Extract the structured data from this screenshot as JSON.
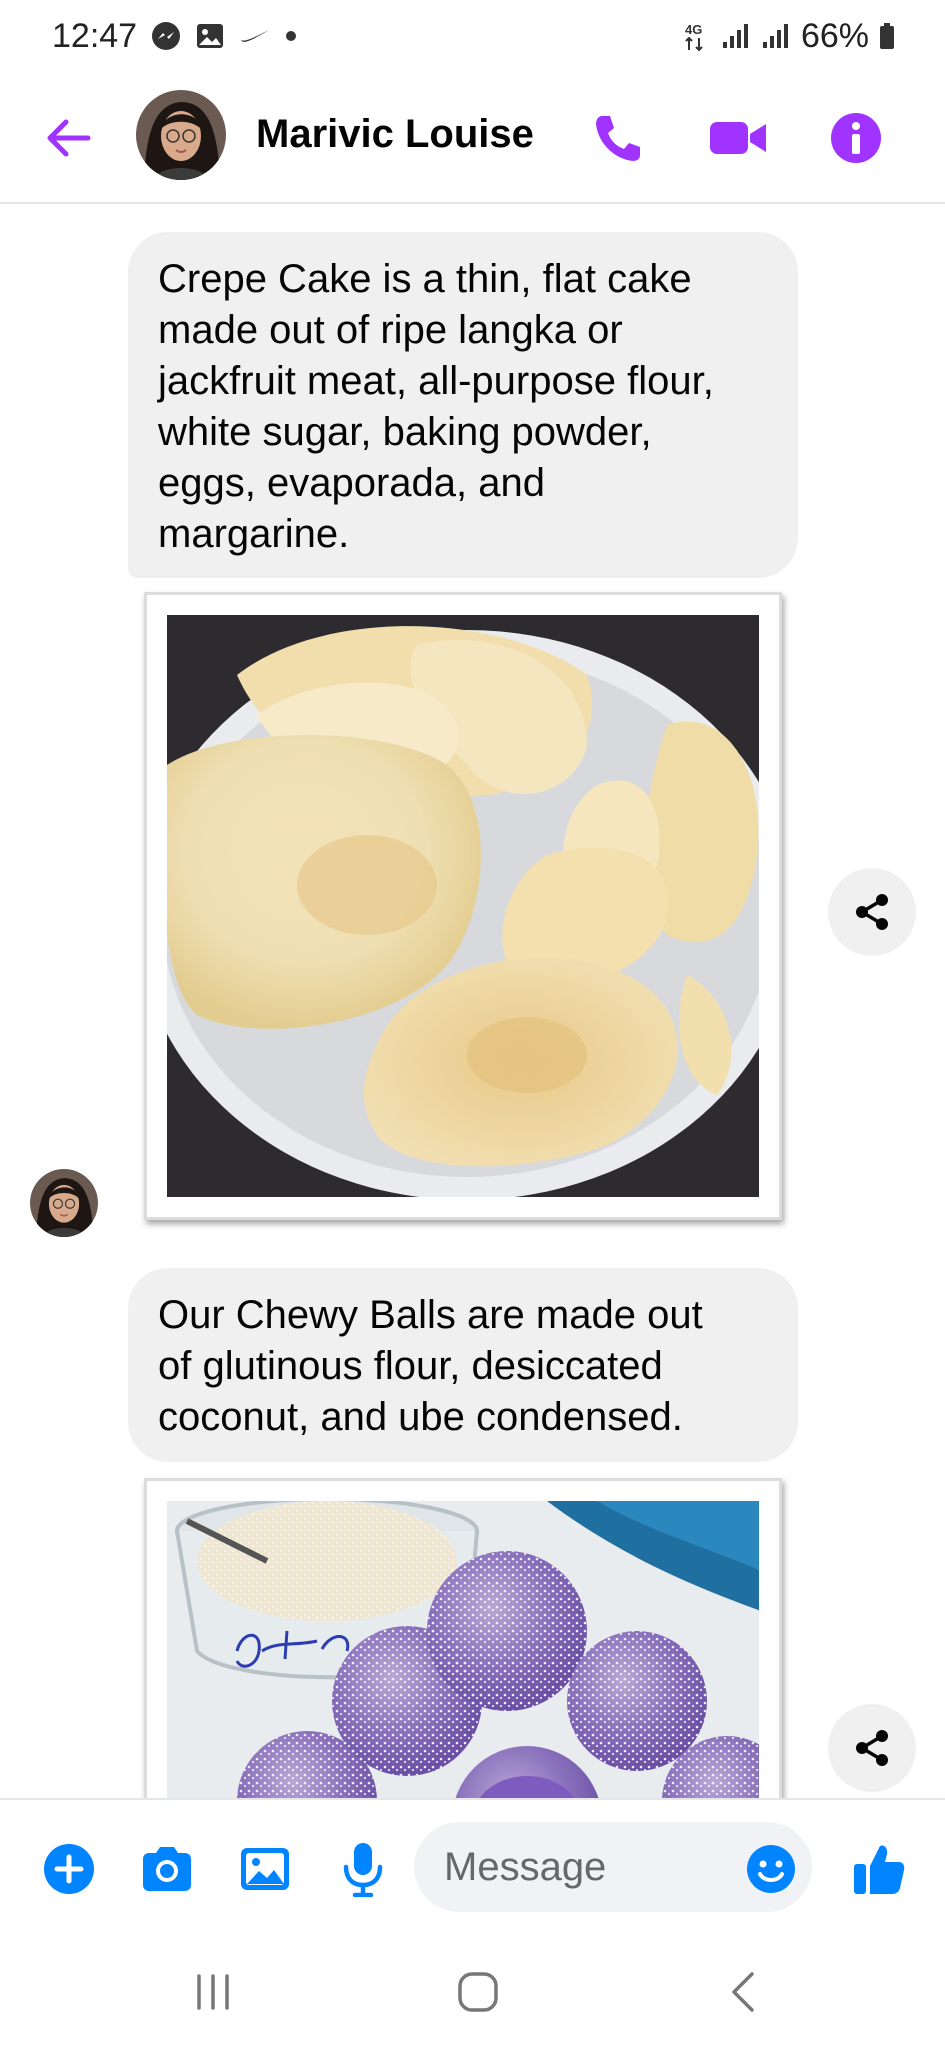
{
  "status_bar": {
    "time": "12:47",
    "network": "4G",
    "battery": "66%"
  },
  "header": {
    "contact_name": "Marivic Louise",
    "accent_color": "#a033ff"
  },
  "messages": [
    {
      "type": "text",
      "text": "Crepe Cake is a thin, flat cake made out of ripe langka or jackfruit meat, all-purpose flour, white sugar, baking powder, eggs, evaporada, and margarine.",
      "lines": [
        "Crepe Cake is a thin, flat cake",
        "made out of ripe langka or",
        "jackfruit meat, all-purpose flour,",
        "white sugar, baking powder,",
        "eggs, evaporada, and",
        "margarine."
      ]
    },
    {
      "type": "image",
      "subject": "crepe-cake-photo"
    },
    {
      "type": "text",
      "text": "Our Chewy Balls are made out of glutinous flour, desiccated coconut, and ube condensed.",
      "lines": [
        "Our Chewy Balls are made out",
        "of glutinous flour, desiccated",
        "coconut, and ube condensed."
      ]
    },
    {
      "type": "image",
      "subject": "chewy-balls-photo"
    }
  ],
  "composer": {
    "placeholder": "Message",
    "accent_color": "#0084ff"
  },
  "icons": {
    "back": "arrow-left-icon",
    "call": "phone-icon",
    "video": "video-camera-icon",
    "info": "info-icon",
    "share": "share-icon",
    "add": "plus-icon",
    "camera": "camera-icon",
    "gallery": "image-icon",
    "mic": "microphone-icon",
    "emoji": "smiley-icon",
    "like": "thumbs-up-icon"
  }
}
